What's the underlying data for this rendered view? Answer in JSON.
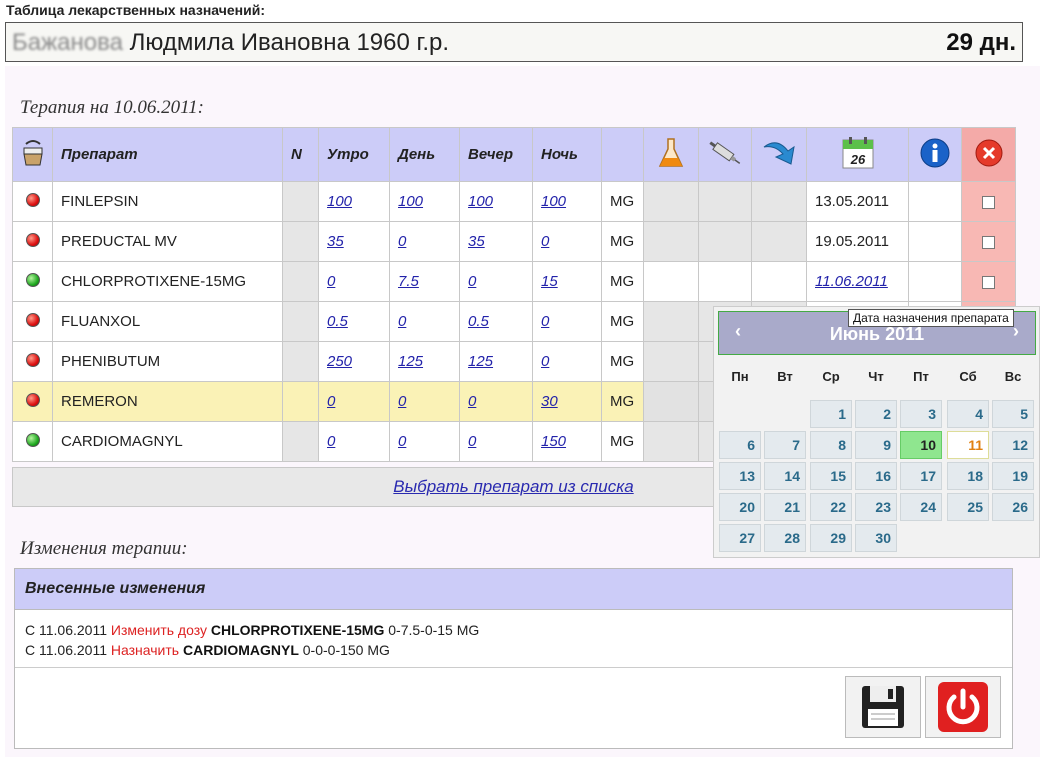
{
  "page_title": "Таблица лекарственных назначений:",
  "patient": {
    "surname": "Бажанова",
    "name_rest": "Людмила Ивановна 1960 г.р.",
    "days": "29 дн."
  },
  "therapy_title": "Терапия на 10.06.2011:",
  "table": {
    "headers": {
      "drug": "Препарат",
      "n": "N",
      "morning": "Утро",
      "day": "День",
      "evening": "Вечер",
      "night": "Ночь"
    },
    "header_icons": [
      "mortar-icon",
      "flask-icon",
      "syringe-icon",
      "arrow-down-icon",
      "calendar-icon",
      "info-icon",
      "delete-icon"
    ],
    "calendar_icon_day": "26",
    "rows": [
      {
        "status": "red",
        "drug": "FINLEPSIN",
        "morning": "100",
        "day": "100",
        "evening": "100",
        "night": "100",
        "unit": "MG",
        "date": "13.05.2011",
        "date_link": false,
        "highlight": false
      },
      {
        "status": "red",
        "drug": "PREDUCTAL MV",
        "morning": "35",
        "day": "0",
        "evening": "35",
        "night": "0",
        "unit": "MG",
        "date": "19.05.2011",
        "date_link": false,
        "highlight": false
      },
      {
        "status": "green",
        "drug": "CHLORPROTIXENE-15MG",
        "morning": "0",
        "day": "7.5",
        "evening": "0",
        "night": "15",
        "unit": "MG",
        "date": "11.06.2011",
        "date_link": true,
        "highlight": false
      },
      {
        "status": "red",
        "drug": "FLUANXOL",
        "morning": "0.5",
        "day": "0",
        "evening": "0.5",
        "night": "0",
        "unit": "MG",
        "date": "",
        "date_link": false,
        "highlight": false
      },
      {
        "status": "red",
        "drug": "PHENIBUTUM",
        "morning": "250",
        "day": "125",
        "evening": "125",
        "night": "0",
        "unit": "MG",
        "date": "",
        "date_link": false,
        "highlight": false
      },
      {
        "status": "red",
        "drug": "REMERON",
        "morning": "0",
        "day": "0",
        "evening": "0",
        "night": "30",
        "unit": "MG",
        "date": "",
        "date_link": false,
        "highlight": true
      },
      {
        "status": "green",
        "drug": "CARDIOMAGNYL",
        "morning": "0",
        "day": "0",
        "evening": "0",
        "night": "150",
        "unit": "MG",
        "date": "",
        "date_link": false,
        "highlight": false
      }
    ],
    "select_link": "Выбрать препарат из списка"
  },
  "tooltip": "Дата назначения препарата",
  "calendar": {
    "month": "Июнь 2011",
    "weekdays": [
      "Пн",
      "Вт",
      "Ср",
      "Чт",
      "Пт",
      "Сб",
      "Вс"
    ],
    "first_weekday_index": 2,
    "days_in_month": 30,
    "selected_day": 10,
    "today_day": 11
  },
  "changes": {
    "title": "Изменения терапии:",
    "header": "Внесенные изменения",
    "items": [
      {
        "prefix": "С 11.06.2011",
        "action": "Изменить дозу",
        "drug": "CHLORPROTIXENE-15MG",
        "dose": "0-7.5-0-15 MG"
      },
      {
        "prefix": "С 11.06.2011",
        "action": "Назначить",
        "drug": "CARDIOMAGNYL",
        "dose": "0-0-0-150 MG"
      }
    ]
  },
  "buttons": {
    "save_icon": "floppy-disk-icon",
    "exit_icon": "power-icon"
  },
  "colors": {
    "header_bg": "#ccccf8",
    "delete_col_bg": "#f8b8b4",
    "highlight_row": "#faf2b6",
    "link": "#2222aa"
  }
}
